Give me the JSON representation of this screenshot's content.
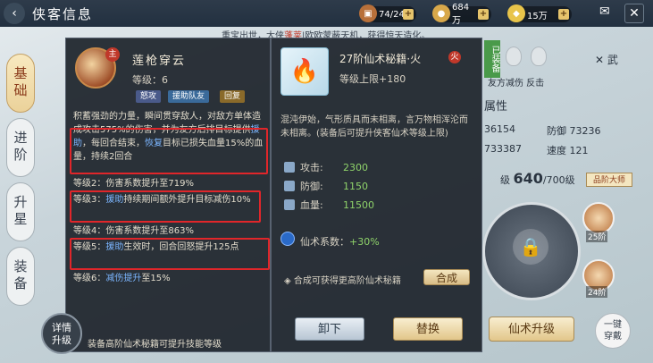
{
  "topbar": {
    "back_icon": "back-arrow-icon",
    "title": "侠客信息",
    "res1": "74/240",
    "res2": "684万",
    "res3": "15万",
    "plus": "+"
  },
  "banner": {
    "prefix": "重宝出世，大侠",
    "name": "蓬莱",
    "suffix": "|欧欧蒙蔽天机，获得惊天造化。"
  },
  "tabs": [
    "基础",
    "进阶",
    "升星",
    "装备"
  ],
  "skill": {
    "lord": "主",
    "name": "莲枪穿云",
    "level": "等级：6",
    "chips": [
      "怒攻",
      "援助队友",
      "回复"
    ],
    "desc1": "积蓄强劲的力量，瞬间贯穿敌人，对敌方单体造成攻击575%的伤害，并为友方后排目标提供",
    "desc_hl1": "援助",
    "desc2": "，每回合结束，",
    "desc_hl2": "恢复",
    "desc3": "目标已损失血量15%的血量，持续2回合",
    "lv2": "等级2：伤害系数提升至719%",
    "lv3_pre": "等级3：",
    "lv3_hl": "援助",
    "lv3_post": "持续期间额外提升目标减伤10%",
    "lv4": "等级4：伤害系数提升至863%",
    "lv5_pre": "等级5：",
    "lv5_hl": "援助",
    "lv5_post": "生效时，回合回怒提升125点",
    "lv6_pre": "等级6：",
    "lv6_hl": "减伤提升",
    "lv6_post": "至15%",
    "detail": "详情",
    "detail2": "升级",
    "footer": "装备高阶仙术秘籍可提升技能等级"
  },
  "book": {
    "name": "27阶仙术秘籍·火",
    "fire": "火",
    "level": "等级上限+180",
    "desc": "混沌伊始，气形质具而未相离，言万物相浑沦而未相离。(装备后可提升侠客仙术等级上限)",
    "stats": [
      {
        "label": "攻击:",
        "value": "2300"
      },
      {
        "label": "防御:",
        "value": "1150"
      },
      {
        "label": "血量:",
        "value": "11500"
      }
    ],
    "coef_label": "仙术系数：",
    "coef_value": "+30%",
    "synth": "合成可获得更高阶仙术秘籍",
    "synth_btn": "合成",
    "unload": "卸下",
    "replace": "替换"
  },
  "right": {
    "gear_badge": "已装备",
    "wu": "武",
    "aid": "友方减伤 反击",
    "attr": "属性",
    "v1": "36154",
    "v2": "防御 73236",
    "v3": "733387",
    "v4": "速度 121",
    "level_pre": "级",
    "level_num": "640",
    "level_post": "/700级",
    "master": "品阶大师",
    "av1": "25阶",
    "av2": "24阶",
    "upgrade": "仙术升级",
    "onekey1": "一键",
    "onekey2": "穿戴"
  }
}
